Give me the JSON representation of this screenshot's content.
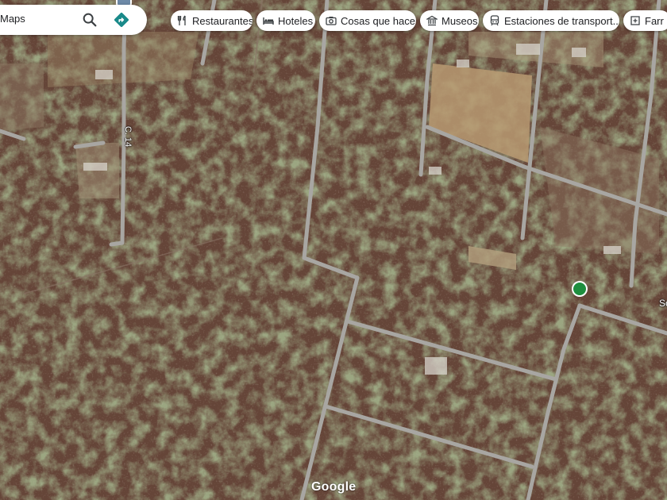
{
  "search": {
    "text": "Maps"
  },
  "chips": [
    {
      "label": "Restaurantes",
      "icon": "restaurant-icon"
    },
    {
      "label": "Hoteles",
      "icon": "hotel-icon"
    },
    {
      "label": "Cosas que hacer",
      "icon": "camera-icon"
    },
    {
      "label": "Museos",
      "icon": "museum-icon"
    },
    {
      "label": "Estaciones de transport...",
      "icon": "transit-icon"
    },
    {
      "label": "Farr",
      "icon": "pharmacy-icon"
    }
  ],
  "map": {
    "street_label": "C. 14",
    "place_label": "Sc",
    "logo": "Google",
    "colors": {
      "terrain_dark": "#4a3a2c",
      "terrain_red": "#6b4a3c",
      "vegetation": "#4e5a34",
      "road": "#a8a6a2",
      "clearing": "#b99a72",
      "pin": "#1e8e3e"
    }
  }
}
